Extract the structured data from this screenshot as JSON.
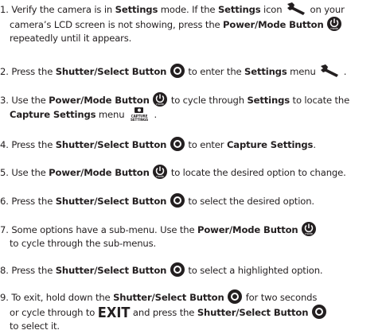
{
  "steps": [
    {
      "num": "1.",
      "l1a": "Verify the camera is in ",
      "l1b": "Settings",
      "l1c": " mode. If the ",
      "l1d": "Settings",
      "l1e": " icon",
      "l1f": " on your",
      "l2a": "camera’s LCD screen is not showing, press the ",
      "l2b": "Power/Mode Button",
      "l3a": "repeatedly until it appears."
    },
    {
      "num": "2.",
      "a": "Press the ",
      "b": "Shutter/Select Button",
      "c": " to enter the ",
      "d": "Settings",
      "e": " menu",
      "f": " ."
    },
    {
      "num": "3.",
      "a": "Use the ",
      "b": "Power/Mode Button",
      "c": " to cycle through ",
      "d": "Settings",
      "e": " to locate the",
      "l2a": "Capture Settings",
      "l2b": " menu",
      "l2c": " ."
    },
    {
      "num": "4.",
      "a": "Press the ",
      "b": "Shutter/Select Button",
      "c": " to enter ",
      "d": "Capture Settings",
      "e": "."
    },
    {
      "num": "5.",
      "a": "Use the ",
      "b": "Power/Mode Button",
      "c": " to locate the desired option to change."
    },
    {
      "num": "6.",
      "a": "Press the ",
      "b": "Shutter/Select Button",
      "c": " to select the desired option."
    },
    {
      "num": "7.",
      "a": "Some options have a sub-menu. Use the ",
      "b": "Power/Mode Button",
      "l2a": "to cycle through the sub-menus."
    },
    {
      "num": "8.",
      "a": "Press the ",
      "b": "Shutter/Select Button",
      "c": " to select a highlighted option."
    },
    {
      "num": "9.",
      "a": "To exit, hold down the ",
      "b": "Shutter/Select Button",
      "c": " for two seconds",
      "l2a": "or cycle through to ",
      "l2b": "EXIT",
      "l2c": " and press the ",
      "l2d": "Shutter/Select Button",
      "l3a": "to select it."
    }
  ],
  "icons": {
    "power_label": "mode",
    "capture_label_1": "CAPTURE",
    "capture_label_2": "SETTINGS"
  }
}
